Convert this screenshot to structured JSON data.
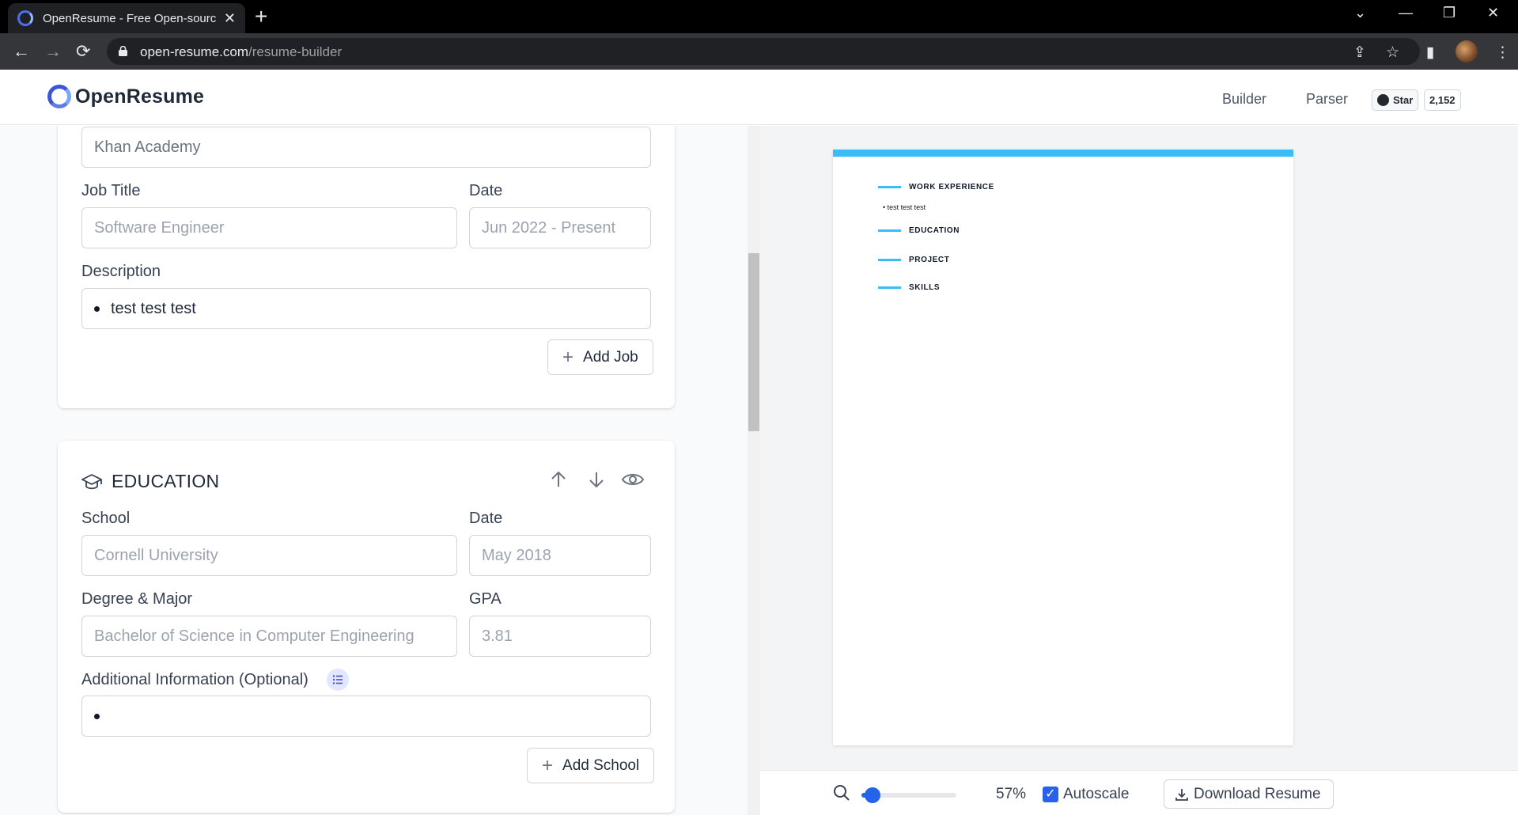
{
  "browser": {
    "tab_title": "OpenResume - Free Open-source",
    "tab_close": "✕",
    "new_tab": "+",
    "url_domain": "open-resume.com",
    "url_path": "/resume-builder",
    "window_controls": {
      "tabsearch": "⌄",
      "minimize": "—",
      "restore": "❐",
      "close": "✕"
    },
    "nav": {
      "back": "←",
      "forward": "→",
      "reload": "⟳"
    },
    "icons": {
      "share": "⇪",
      "bookmark": "☆",
      "sidepanel": "▮",
      "menu": "⋮"
    }
  },
  "header": {
    "logo_text": "OpenResume",
    "nav_builder": "Builder",
    "nav_parser": "Parser",
    "github_star": "Star",
    "github_count": "2,152"
  },
  "work": {
    "company_value": "Khan Academy",
    "job_title_label": "Job Title",
    "job_title_value": "Software Engineer",
    "date_label": "Date",
    "date_value": "Jun 2022 - Present",
    "description_label": "Description",
    "description_bullet": "test test test",
    "add_button": "Add Job",
    "plus": "+"
  },
  "education": {
    "title": "EDUCATION",
    "school_label": "School",
    "school_value": "Cornell University",
    "date_label": "Date",
    "date_value": "May 2018",
    "degree_label": "Degree & Major",
    "degree_value": "Bachelor of Science in Computer Engineering",
    "gpa_label": "GPA",
    "gpa_value": "3.81",
    "additional_label": "Additional Information (Optional)",
    "add_button": "Add School",
    "plus": "+"
  },
  "preview": {
    "headings": [
      "WORK EXPERIENCE",
      "EDUCATION",
      "PROJECT",
      "SKILLS"
    ],
    "bullet_text": "• test test test",
    "accent_color": "#38bdf8"
  },
  "toolbar": {
    "zoom_value": "57%",
    "zoom_level": 0.57,
    "autoscale_checked": "✓",
    "autoscale_label": "Autoscale",
    "download_label": "Download Resume"
  }
}
